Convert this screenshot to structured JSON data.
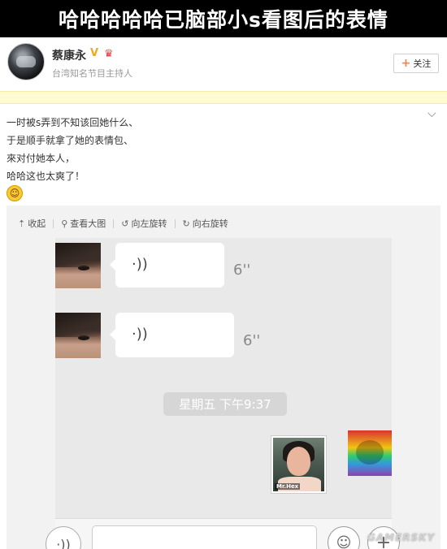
{
  "banner": {
    "title": "哈哈哈哈哈已脑部小s看图后的表情"
  },
  "profile": {
    "name": "蔡康永",
    "verified_icon": "V",
    "title": "台湾知名节目主持人",
    "follow_label": "关注",
    "accent": "#ff8140"
  },
  "post": {
    "lines": [
      "一时被s弄到不知该回她什么、",
      "于是顺手就拿了她的表情包、",
      "來对付她本人，",
      "哈哈这也太爽了！"
    ],
    "emoji": "grin-emoji"
  },
  "toolbar": {
    "collapse": "收起",
    "view_large": "查看大图",
    "rotate_left": "向左旋转",
    "rotate_right": "向右旋转"
  },
  "chat": {
    "messages": [
      {
        "duration": "6''",
        "icon": "voice-wave-icon"
      },
      {
        "duration": "6''",
        "icon": "voice-wave-icon"
      }
    ],
    "timestamp": "星期五 下午9:37",
    "photo_tag": "Mr.Hex"
  },
  "watermark": "GAMERSKY"
}
